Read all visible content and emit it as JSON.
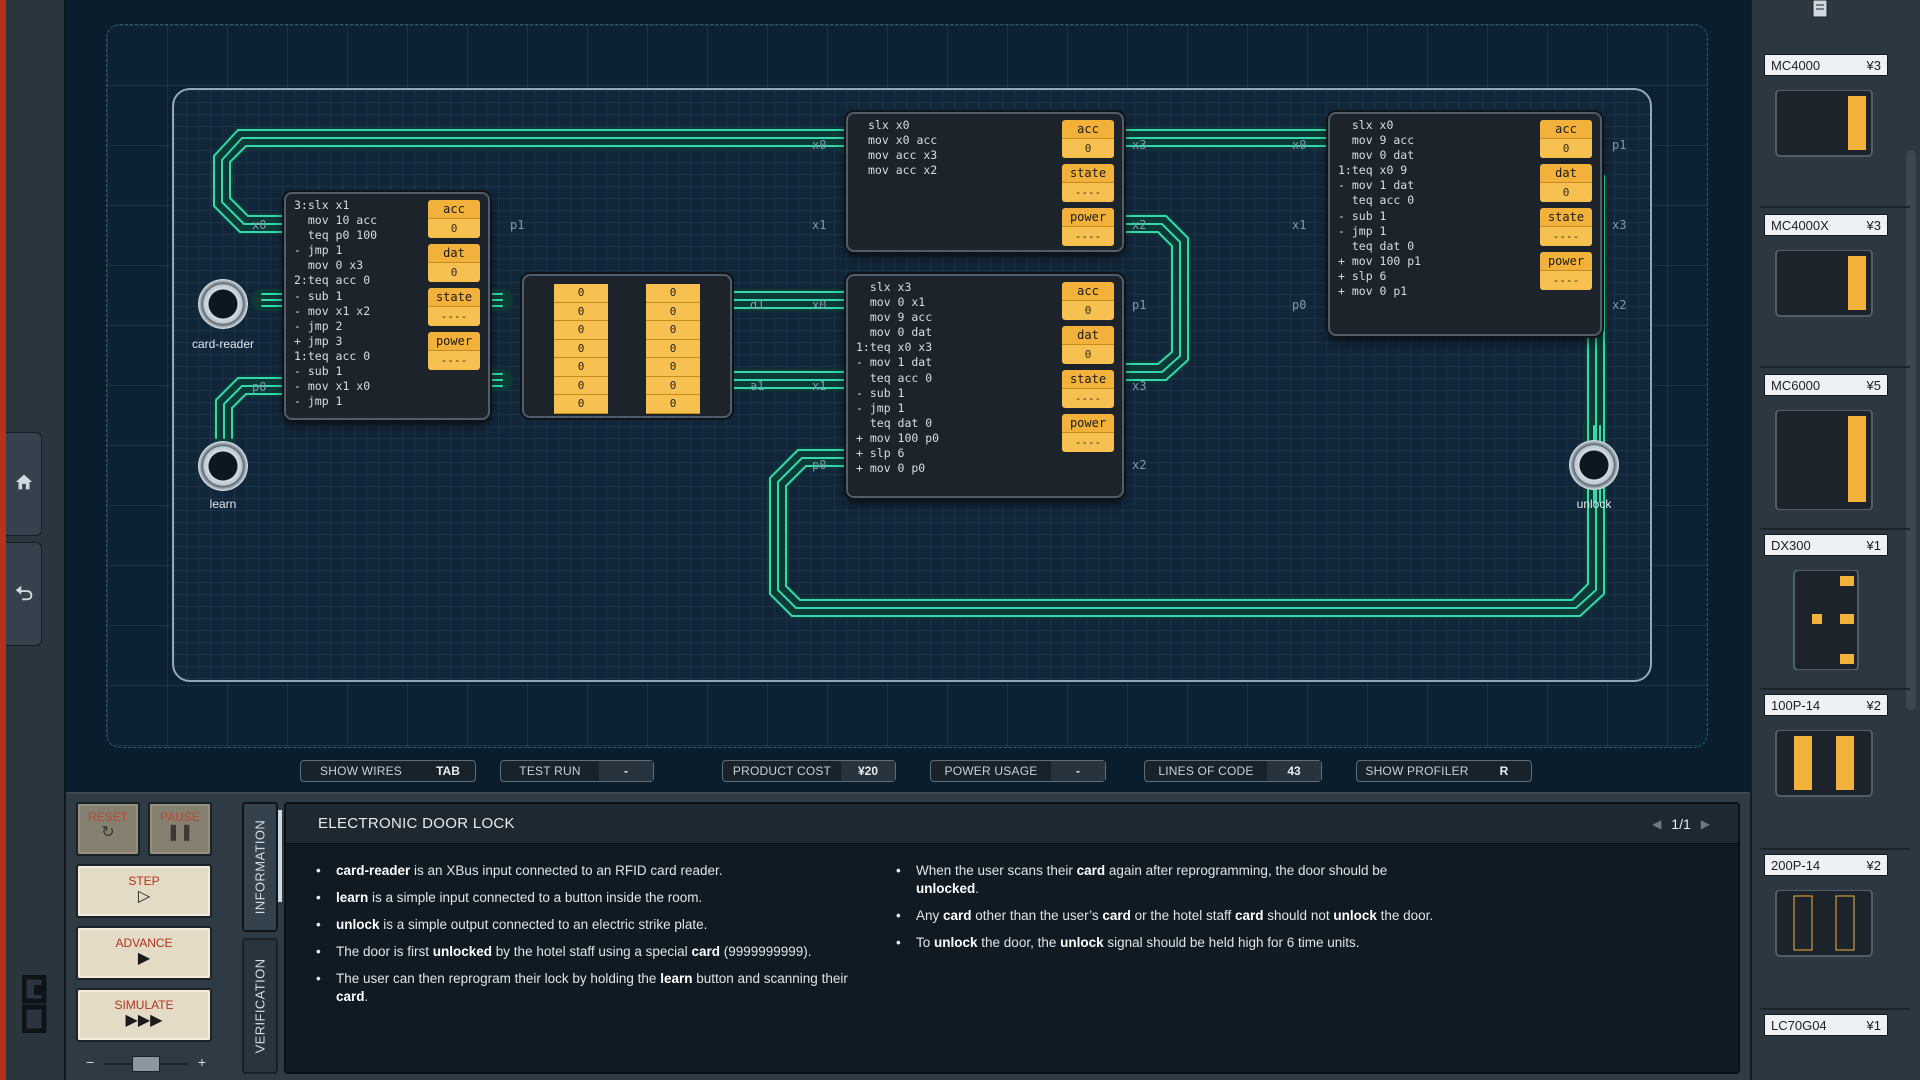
{
  "board": {
    "card_reader_label": "card-reader",
    "learn_label": "learn",
    "unlock_label": "unlock",
    "chips": {
      "c1": {
        "code": "3:slx x1\n  mov 10 acc\n  teq p0 100\n- jmp 1\n  mov 0 x3\n2:teq acc 0\n- sub 1\n- mov x1 x2\n- jmp 2\n+ jmp 3\n1:teq acc 0\n- sub 1\n- mov x1 x0\n- jmp 1",
        "regs": [
          {
            "label": "acc",
            "value": "0"
          },
          {
            "label": "dat",
            "value": "0"
          },
          {
            "label": "state",
            "value": "----"
          },
          {
            "label": "power",
            "value": "----"
          }
        ],
        "pins": {
          "x0": "x0",
          "p0": "p0",
          "p1": "p1"
        }
      },
      "c2": {
        "code": "slx x0\nmov x0 acc\nmov acc x3\nmov acc x2",
        "regs": [
          {
            "label": "acc",
            "value": "0"
          },
          {
            "label": "state",
            "value": "----"
          },
          {
            "label": "power",
            "value": "----"
          }
        ],
        "pins": {
          "x0": "x0",
          "x1": "x1",
          "x3": "x3",
          "x2": "x2"
        }
      },
      "c3": {
        "code": "  slx x3\n  mov 0 x1\n  mov 9 acc\n  mov 0 dat\n1:teq x0 x3\n- mov 1 dat\n  teq acc 0\n- sub 1\n- jmp 1\n  teq dat 0\n+ mov 100 p0\n+ slp 6\n+ mov 0 p0",
        "regs": [
          {
            "label": "acc",
            "value": "0"
          },
          {
            "label": "dat",
            "value": "0"
          },
          {
            "label": "state",
            "value": "----"
          },
          {
            "label": "power",
            "value": "----"
          }
        ],
        "pins": {
          "x0": "x0",
          "x1": "x1",
          "p0": "p0",
          "p1": "p1",
          "x3": "x3",
          "x2": "x2"
        }
      },
      "c4": {
        "code": "  slx x0\n  mov 9 acc\n  mov 0 dat\n1:teq x0 9\n- mov 1 dat\n  teq acc 0\n- sub 1\n- jmp 1\n  teq dat 0\n+ mov 100 p1\n+ slp 6\n+ mov 0 p1",
        "regs": [
          {
            "label": "acc",
            "value": "0"
          },
          {
            "label": "dat",
            "value": "0"
          },
          {
            "label": "state",
            "value": "----"
          },
          {
            "label": "power",
            "value": "----"
          }
        ],
        "pins": {
          "x0": "x0",
          "x1": "x1",
          "p0": "p0",
          "p1": "p1",
          "x3": "x3",
          "x2": "x2"
        }
      }
    },
    "memory": {
      "col_a": [
        "0",
        "0",
        "0",
        "0",
        "0",
        "0",
        "0"
      ],
      "col_b": [
        "0",
        "0",
        "0",
        "0",
        "0",
        "0",
        "0"
      ],
      "pins": {
        "d1": "d1",
        "a1": "a1"
      }
    }
  },
  "status_bar": {
    "show_wires": {
      "label": "SHOW WIRES",
      "value": "TAB"
    },
    "test_run": {
      "label": "TEST RUN",
      "value": "-"
    },
    "product_cost": {
      "label": "PRODUCT COST",
      "value": "¥20"
    },
    "power_usage": {
      "label": "POWER USAGE",
      "value": "-"
    },
    "lines_of_code": {
      "label": "LINES OF CODE",
      "value": "43"
    },
    "show_profiler": {
      "label": "SHOW PROFILER",
      "value": "R"
    }
  },
  "controls": {
    "reset": "RESET",
    "pause": "PAUSE",
    "step": "STEP",
    "advance": "ADVANCE",
    "simulate": "SIMULATE",
    "slider_minus": "−",
    "slider_plus": "+"
  },
  "tabs": {
    "information": "INFORMATION",
    "verification": "VERIFICATION"
  },
  "info": {
    "title": "ELECTRONIC DOOR LOCK",
    "page": "1/1"
  },
  "sidebar": {
    "parts": [
      {
        "name": "MC4000",
        "cost": "¥3"
      },
      {
        "name": "MC4000X",
        "cost": "¥3"
      },
      {
        "name": "MC6000",
        "cost": "¥5"
      },
      {
        "name": "DX300",
        "cost": "¥1"
      },
      {
        "name": "100P-14",
        "cost": "¥2"
      },
      {
        "name": "200P-14",
        "cost": "¥2"
      },
      {
        "name": "LC70G04",
        "cost": "¥1"
      }
    ]
  },
  "colors": {
    "wire": "#35d6b0",
    "register": "#f2b13b",
    "accent_red": "#b3321e"
  },
  "icons": {
    "home": "home-icon",
    "undo": "undo-icon",
    "manual": "manual-icon"
  }
}
